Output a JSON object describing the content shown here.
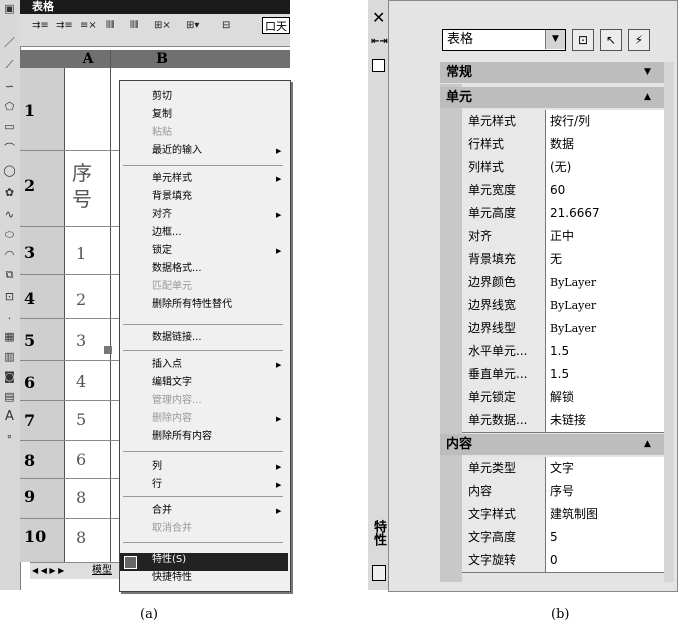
{
  "panel_a": {
    "title": "表格",
    "input_value": "口天",
    "col_headers": [
      "A",
      "B"
    ],
    "row_headers": [
      "1",
      "2",
      "3",
      "4",
      "5",
      "6",
      "7",
      "8",
      "9",
      "10"
    ],
    "cells_col_a": [
      "序号",
      "1",
      "2",
      "3",
      "4",
      "5",
      "6",
      "8",
      "8"
    ],
    "tab_model": "模型",
    "tab_nav": "◀ ◀ ▶ ▶",
    "context_menu": {
      "items": [
        {
          "label": "剪切",
          "disabled": false,
          "submenu": false
        },
        {
          "label": "复制",
          "disabled": false,
          "submenu": false
        },
        {
          "label": "粘贴",
          "disabled": true,
          "submenu": false
        },
        {
          "label": "最近的输入",
          "disabled": false,
          "submenu": true
        },
        {
          "label": "单元样式",
          "disabled": false,
          "submenu": true
        },
        {
          "label": "背景填充",
          "disabled": false,
          "submenu": false
        },
        {
          "label": "对齐",
          "disabled": false,
          "submenu": true
        },
        {
          "label": "边框...",
          "disabled": false,
          "submenu": false
        },
        {
          "label": "锁定",
          "disabled": false,
          "submenu": true
        },
        {
          "label": "数据格式...",
          "disabled": false,
          "submenu": false
        },
        {
          "label": "匹配单元",
          "disabled": true,
          "submenu": false
        },
        {
          "label": "删除所有特性替代",
          "disabled": false,
          "submenu": false
        },
        {
          "label": "数据链接...",
          "disabled": false,
          "submenu": false
        },
        {
          "label": "插入点",
          "disabled": false,
          "submenu": true
        },
        {
          "label": "编辑文字",
          "disabled": false,
          "submenu": false
        },
        {
          "label": "管理内容...",
          "disabled": true,
          "submenu": false
        },
        {
          "label": "删除内容",
          "disabled": true,
          "submenu": true
        },
        {
          "label": "删除所有内容",
          "disabled": false,
          "submenu": false
        },
        {
          "label": "列",
          "disabled": false,
          "submenu": true
        },
        {
          "label": "行",
          "disabled": false,
          "submenu": true
        },
        {
          "label": "合并",
          "disabled": false,
          "submenu": true
        },
        {
          "label": "取消合并",
          "disabled": true,
          "submenu": false
        },
        {
          "label": "特性(S)",
          "disabled": false,
          "submenu": false,
          "highlighted": true
        },
        {
          "label": "快捷特性",
          "disabled": false,
          "submenu": false
        }
      ]
    },
    "caption": "(a)"
  },
  "panel_b": {
    "object_type": "表格",
    "vertical_title": "特性",
    "sections": [
      {
        "title": "常规",
        "collapsed": true,
        "rows": []
      },
      {
        "title": "单元",
        "collapsed": false,
        "rows": [
          {
            "label": "单元样式",
            "value": "按行/列"
          },
          {
            "label": "行样式",
            "value": "数据"
          },
          {
            "label": "列样式",
            "value": "(无)"
          },
          {
            "label": "单元宽度",
            "value": "60"
          },
          {
            "label": "单元高度",
            "value": "21.6667"
          },
          {
            "label": "对齐",
            "value": "正中"
          },
          {
            "label": "背景填充",
            "value": "无"
          },
          {
            "label": "边界颜色",
            "value": "ByLayer"
          },
          {
            "label": "边界线宽",
            "value": "ByLayer"
          },
          {
            "label": "边界线型",
            "value": "ByLayer"
          },
          {
            "label": "水平单元...",
            "value": "1.5"
          },
          {
            "label": "垂直单元...",
            "value": "1.5"
          },
          {
            "label": "单元锁定",
            "value": "解锁"
          },
          {
            "label": "单元数据...",
            "value": "未链接"
          }
        ]
      },
      {
        "title": "内容",
        "collapsed": false,
        "rows": [
          {
            "label": "单元类型",
            "value": "文字"
          },
          {
            "label": "内容",
            "value": "序号"
          },
          {
            "label": "文字样式",
            "value": "建筑制图"
          },
          {
            "label": "文字高度",
            "value": "5"
          },
          {
            "label": "文字旋转",
            "value": "0"
          }
        ]
      }
    ],
    "caption": "(b)"
  }
}
